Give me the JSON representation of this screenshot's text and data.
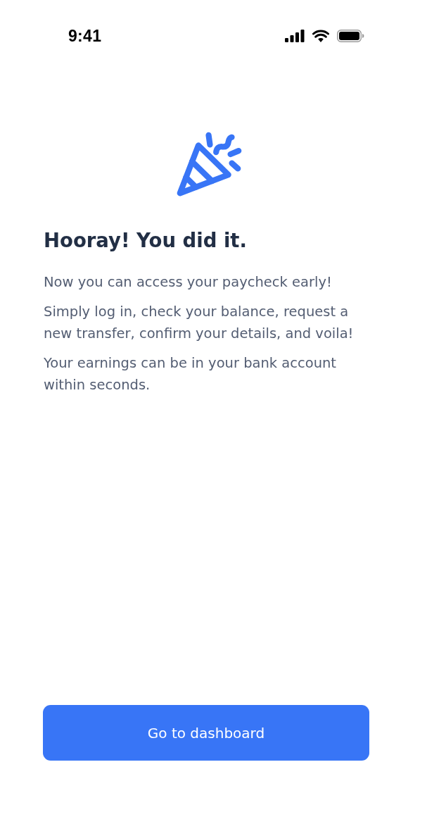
{
  "status_bar": {
    "time": "9:41"
  },
  "title": "Hooray! You did it.",
  "paragraphs": [
    "Now you can access your paycheck early!",
    "Simply log in, check your balance, request a new transfer, confirm your details, and voila!",
    "Your earnings can be in your bank account within seconds."
  ],
  "primary_button": {
    "label": "Go to dashboard"
  }
}
